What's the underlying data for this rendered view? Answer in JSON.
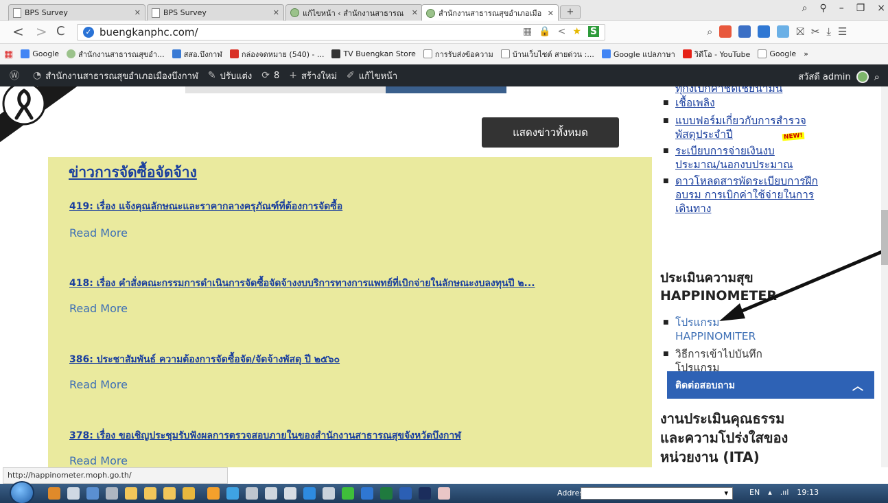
{
  "tabs": [
    {
      "label": "BPS Survey",
      "type": "doc",
      "active": false
    },
    {
      "label": "BPS Survey",
      "type": "doc",
      "active": false
    },
    {
      "label": "แก้ไขหน้า ‹ สำนักงานสาธารณ",
      "type": "site",
      "active": false
    },
    {
      "label": "สำนักงานสาธารณสุขอำเภอเมือ",
      "type": "site",
      "active": true
    }
  ],
  "newtab_label": "+",
  "window_controls": [
    "⌕",
    "⚲",
    "–",
    "❐",
    "×"
  ],
  "address": {
    "url": "buengkanphc.com/"
  },
  "bookmarks": [
    {
      "label": "Google",
      "icon_color": "#4285f4",
      "icon": "google-icon"
    },
    {
      "label": "สำนักงานสาธารณสุขอำ...",
      "icon_color": "#9bc28b",
      "icon": "site-icon"
    },
    {
      "label": "สสอ.บึงกาฬ",
      "icon_color": "#3a7bd5",
      "icon": "people-icon"
    },
    {
      "label": "กล่องจดหมาย (540) - ...",
      "icon_color": "#d93025",
      "icon": "gmail-icon"
    },
    {
      "label": "TV Buengkan Store",
      "icon_color": "#333",
      "icon": "hat-icon"
    },
    {
      "label": "การรับส่งข้อความ",
      "icon_color": "#fff",
      "icon": "doc-icon"
    },
    {
      "label": "บ้านเว็บไซต์ สายด่วน :...",
      "icon_color": "#fff",
      "icon": "doc-icon"
    },
    {
      "label": "Google แปลภาษา",
      "icon_color": "#4285f4",
      "icon": "translate-icon"
    },
    {
      "label": "วิดีโอ - YouTube",
      "icon_color": "#e62117",
      "icon": "youtube-icon"
    },
    {
      "label": "Google",
      "icon_color": "#fff",
      "icon": "doc-icon"
    },
    {
      "label": "»",
      "icon_color": "",
      "icon": ""
    }
  ],
  "wpbar": {
    "site_name": "สำนักงานสาธารณสุขอำเภอเมืองบึงกาฬ",
    "customize": "ปรับแต่ง",
    "updates": "8",
    "new": "สร้างใหม่",
    "edit_page": "แก้ไขหน้า",
    "greeting": "สวัสดี admin"
  },
  "main": {
    "show_all_button": "แสดงข่าวทั้งหมด",
    "news_title": "ข่าวการจัดซื้อจัดจ้าง",
    "read_more": "Read More",
    "news": [
      {
        "title": "419: เรื่อง แจ้งคุณลักษณะและราคากลางครุภัณฑ์ที่ต้องการจัดซื้อ"
      },
      {
        "title": "418: เรื่อง คำสั่งคณะกรรมการดำเนินการจัดซื้อจัดจ้างงบบริการทางการแพทย์ที่เบิกจ่ายในลักษณะงบลงทุนปี ๒..."
      },
      {
        "title": "386: ประชาสัมพันธ์ ความต้องการจัดซื้อจัด/จัดจ้างพัสดุ ปี ๒๕๖๐"
      },
      {
        "title": "378: เรื่อง ขอเชิญประชุมรับฟังผลการตรวจสอบภายในของสำนักงานสาธารณสุขจังหวัดบึงกาฬ"
      }
    ]
  },
  "sidebar": {
    "top_cut_text": "ทุกงเบิกค่าชดเชยน้ำมัน",
    "links": [
      "เชื้อเพลิง",
      "แบบฟอร์มเกี่ยวกับการสำรวจพัสดุประจำปี",
      "ระเบียบการจ่ายเงินงบประมาณ/นอกงบประมาณ",
      "ดาวโหลดสารพัดระเบียบการฝึกอบรม การเบิกค่าใช้จ่ายในการเดินทาง"
    ],
    "new_badge": "NEW!",
    "happy_heading": "ประเมินความสุข HAPPINOMETER",
    "happy_links": [
      "โปรแกรม HAPPINOMITER",
      "วิธีการเข้าไปบันทึก โปรแกรม"
    ],
    "ita_heading": "งานประเมินคุณธรรมและความโปร่งใสของหน่วยงาน (ITA)"
  },
  "contact_label": "ติดต่อสอบถาม",
  "status_url": "http://happinometer.moph.go.th/",
  "taskbar": {
    "address_label": "Address",
    "address_value": "",
    "lang": "EN",
    "time": "19:13"
  }
}
